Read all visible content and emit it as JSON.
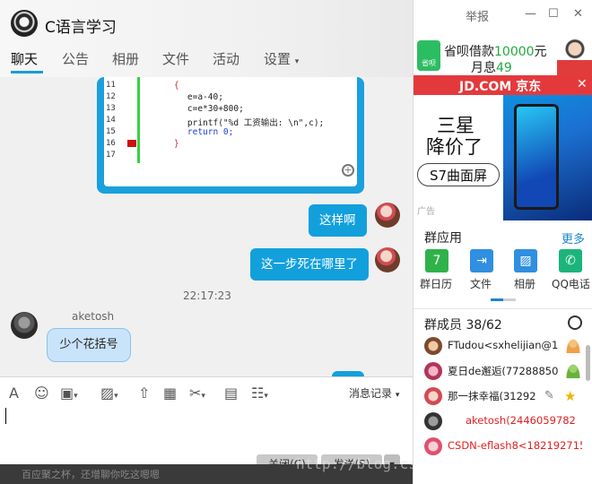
{
  "window": {
    "title": "C语言学习",
    "report": "举报",
    "minimize": "—",
    "maximize": "☐",
    "close": "✕"
  },
  "tabs": [
    "聊天",
    "公告",
    "相册",
    "文件",
    "活动",
    "设置"
  ],
  "code": {
    "lines": [
      "11",
      "12",
      "13",
      "14",
      "15",
      "16",
      "17"
    ],
    "text": [
      "{",
      "    e=a-40;",
      "    c=e*30+800;",
      "    printf(\"%d 工资输出: \\n\",c);",
      "    return 0;",
      "}",
      ""
    ]
  },
  "chat": {
    "msg1": "这样啊",
    "msg2": "这一步死在哪里了",
    "timestamp": "22:17:23",
    "sender": "aketosh",
    "msg3": "少个花括号"
  },
  "input": {
    "record_label": "消息记录",
    "record_caret": "▾",
    "close_label": "关闭(C)",
    "send_label": "发送(S)",
    "send_arrow": "▾",
    "footer_hint": "百应聚之杯，还增聊你吃这嗯嗯",
    "watermark": "http://blog.csdn.net/qq_22653893"
  },
  "ads": {
    "loan_icon": "省呗",
    "loan_line1a": "省呗借款",
    "loan_line1b": "10000",
    "loan_line1c": "元",
    "loan_line2a": "月息",
    "loan_line2b": "49",
    "jd_header": "JD.COM 京东",
    "jd_close": "✕",
    "phone_t1": "三星",
    "phone_t2": "降价了",
    "phone_t3": "S7曲面屏",
    "ad_tag": "广告"
  },
  "apps": {
    "title": "群应用",
    "more": "更多",
    "items": [
      "群日历",
      "文件",
      "相册",
      "QQ电话"
    ]
  },
  "members": {
    "title": "群成员 38/62",
    "list": [
      "FTudou<sxhelijian@163.c",
      "夏日de邂逅(77288850)",
      "那一抹幸福(31292",
      "aketosh(2446059782)",
      "CSDN-eflash8<18219271587>"
    ]
  },
  "colors": {
    "accent": "#1aa0dc",
    "jd_red": "#e4393c",
    "highlight_red": "#e12020"
  }
}
